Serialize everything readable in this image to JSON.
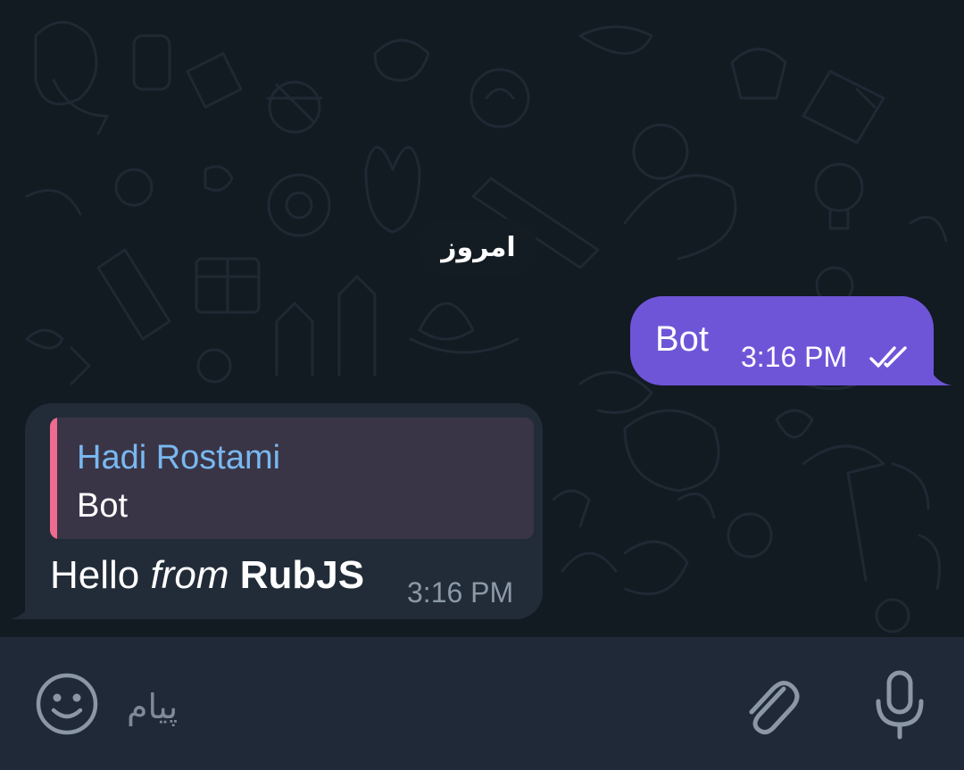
{
  "chat": {
    "date_separator": "امروز",
    "outgoing": {
      "text": "Bot",
      "time": "3:16 PM",
      "status": "read"
    },
    "incoming": {
      "reply": {
        "author": "Hadi Rostami",
        "text": "Bot"
      },
      "text_plain": "Hello ",
      "text_italic": "from",
      "text_bold": "RubJS",
      "time": "3:16 PM"
    }
  },
  "composer": {
    "placeholder": "پیام"
  },
  "colors": {
    "background": "#121a22",
    "outgoing_bubble": "#6e55d8",
    "incoming_bubble": "#222c38",
    "quote_background": "#3a3546",
    "quote_accent": "#ef6b8f",
    "quote_author": "#79b8f0",
    "input_bar": "#1f2937"
  },
  "icons": [
    "emoji-icon",
    "attach-icon",
    "mic-icon",
    "double-check-icon"
  ]
}
